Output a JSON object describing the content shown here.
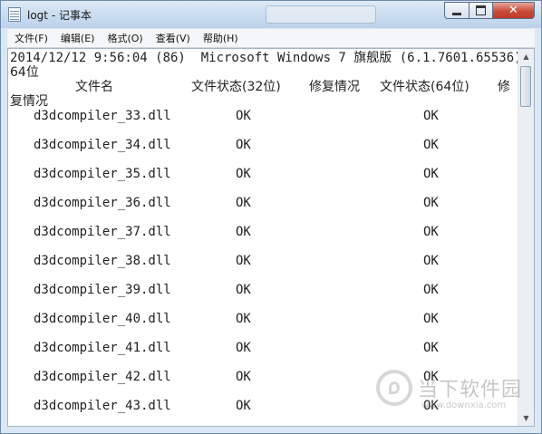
{
  "window": {
    "title": "logt - 记事本"
  },
  "menu": [
    "文件(F)",
    "编辑(E)",
    "格式(O)",
    "查看(V)",
    "帮助(H)"
  ],
  "content": {
    "line1": "2014/12/12 9:56:04 (86)  Microsoft Windows 7 旗舰版 (6.1.7601.65536)",
    "line2": "64位",
    "header": {
      "name": "文件名",
      "status32": "文件状态(32位)",
      "repair": "修复情况",
      "status64": "文件状态(64位)",
      "repair_part1": "修",
      "repair_part2": "复情况"
    },
    "rows": [
      {
        "name": "d3dcompiler_33.dll",
        "status32": "OK",
        "status64": "OK"
      },
      {
        "name": "d3dcompiler_34.dll",
        "status32": "OK",
        "status64": "OK"
      },
      {
        "name": "d3dcompiler_35.dll",
        "status32": "OK",
        "status64": "OK"
      },
      {
        "name": "d3dcompiler_36.dll",
        "status32": "OK",
        "status64": "OK"
      },
      {
        "name": "d3dcompiler_37.dll",
        "status32": "OK",
        "status64": "OK"
      },
      {
        "name": "d3dcompiler_38.dll",
        "status32": "OK",
        "status64": "OK"
      },
      {
        "name": "d3dcompiler_39.dll",
        "status32": "OK",
        "status64": "OK"
      },
      {
        "name": "d3dcompiler_40.dll",
        "status32": "OK",
        "status64": "OK"
      },
      {
        "name": "d3dcompiler_41.dll",
        "status32": "OK",
        "status64": "OK"
      },
      {
        "name": "d3dcompiler_42.dll",
        "status32": "OK",
        "status64": "OK"
      },
      {
        "name": "d3dcompiler_43.dll",
        "status32": "OK",
        "status64": "OK"
      }
    ]
  },
  "watermark": {
    "brand": "当下软件园",
    "url": "www.downxia.com"
  },
  "icons": {
    "app": "notepad-icon",
    "minimize": "minimize-icon",
    "maximize": "maximize-icon",
    "close": "close-icon",
    "scroll_up": "arrow-up-icon",
    "scroll_down": "arrow-down-icon"
  }
}
